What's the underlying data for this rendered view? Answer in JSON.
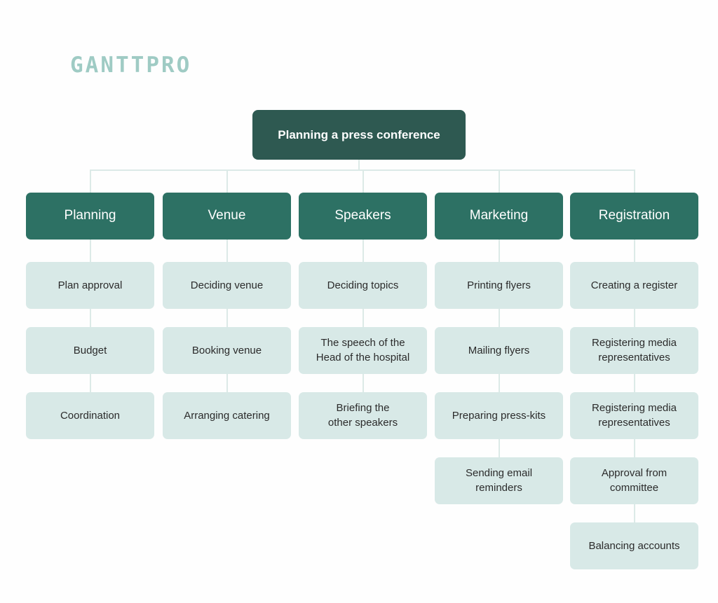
{
  "brand": {
    "logo_text": "GANTTPRO"
  },
  "colors": {
    "background": "#fefefe",
    "logo": "#9fcbc4",
    "root_node": "#2e5951",
    "branch_node": "#2d7164",
    "leaf_node": "#d8e9e7",
    "connector": "#dceae7",
    "leaf_text": "#2b2b2b",
    "node_text": "#ffffff"
  },
  "chart_data": {
    "type": "diagram",
    "diagram_type": "work-breakdown-structure",
    "title": "Planning a press conference",
    "root": "Planning a press conference",
    "branches": [
      {
        "label": "Planning",
        "tasks": [
          "Plan approval",
          "Budget",
          "Coordination"
        ]
      },
      {
        "label": "Venue",
        "tasks": [
          "Deciding venue",
          "Booking venue",
          "Arranging catering"
        ]
      },
      {
        "label": "Speakers",
        "tasks": [
          "Deciding topics",
          "The speech of the Head of the hospital",
          "Briefing the other speakers"
        ]
      },
      {
        "label": "Marketing",
        "tasks": [
          "Printing flyers",
          "Mailing flyers",
          "Preparing press-kits",
          "Sending email reminders"
        ]
      },
      {
        "label": "Registration",
        "tasks": [
          "Creating a register",
          "Registering media representatives",
          "Registering media representatives",
          "Approval from committee",
          "Balancing accounts"
        ]
      }
    ]
  },
  "diagram": {
    "root": {
      "label": "Planning a press conference"
    },
    "columns": [
      {
        "branch": "Planning",
        "leaves": [
          {
            "line1": "Plan approval",
            "line2": ""
          },
          {
            "line1": "Budget",
            "line2": ""
          },
          {
            "line1": "Coordination",
            "line2": ""
          }
        ]
      },
      {
        "branch": "Venue",
        "leaves": [
          {
            "line1": "Deciding venue",
            "line2": ""
          },
          {
            "line1": "Booking venue",
            "line2": ""
          },
          {
            "line1": "Arranging catering",
            "line2": ""
          }
        ]
      },
      {
        "branch": "Speakers",
        "leaves": [
          {
            "line1": "Deciding topics",
            "line2": ""
          },
          {
            "line1": "The speech of the",
            "line2": "Head of the hospital"
          },
          {
            "line1": "Briefing the",
            "line2": "other speakers"
          }
        ]
      },
      {
        "branch": "Marketing",
        "leaves": [
          {
            "line1": "Printing flyers",
            "line2": ""
          },
          {
            "line1": "Mailing flyers",
            "line2": ""
          },
          {
            "line1": "Preparing press-kits",
            "line2": ""
          },
          {
            "line1": "Sending email",
            "line2": "reminders"
          }
        ]
      },
      {
        "branch": "Registration",
        "leaves": [
          {
            "line1": "Creating a register",
            "line2": ""
          },
          {
            "line1": "Registering media",
            "line2": "representatives"
          },
          {
            "line1": "Registering media",
            "line2": "representatives"
          },
          {
            "line1": "Approval from",
            "line2": "committee"
          },
          {
            "line1": "Balancing accounts",
            "line2": ""
          }
        ]
      }
    ]
  }
}
